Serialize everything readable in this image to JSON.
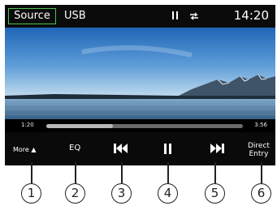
{
  "statusbar": {
    "source_label": "Source",
    "source_name": "USB",
    "clock": "14:20",
    "play_state_icon": "pause-icon",
    "repeat_icon": "repeat-icon"
  },
  "progress": {
    "elapsed": "1:20",
    "total": "3:56",
    "fraction": 0.34
  },
  "controls": {
    "more_label": "More",
    "more_arrow": "▲",
    "eq_label": "EQ",
    "direct_line1": "Direct",
    "direct_line2": "Entry"
  },
  "callouts": [
    "1",
    "2",
    "3",
    "4",
    "5",
    "6"
  ]
}
